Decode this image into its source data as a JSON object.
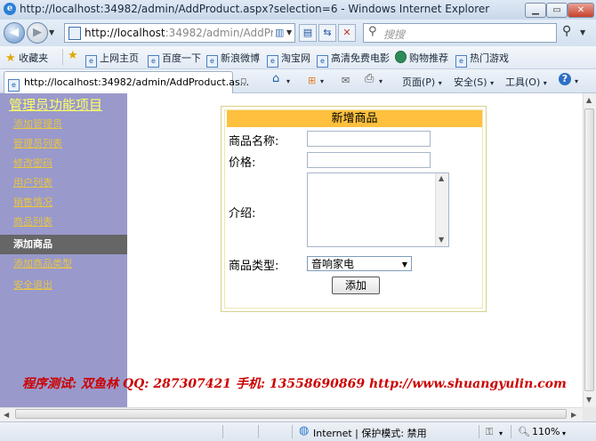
{
  "window": {
    "title": "http://localhost:34982/admin/AddProduct.aspx?selection=6 - Windows Internet Explorer",
    "min_icon": "minimize-icon",
    "max_icon": "maximize-icon",
    "close_icon": "close-icon"
  },
  "address": {
    "url_host": "http://localhost",
    "url_rest": ":34982/admin/AddProduc",
    "search_placeholder": "搜搜"
  },
  "favorites": {
    "label": "收藏夹",
    "items": [
      "上网主页",
      "百度一下",
      "新浪微博",
      "淘宝网",
      "高清免费电影",
      "购物推荐",
      "热门游戏"
    ]
  },
  "tab": {
    "title": "http://localhost:34982/admin/AddProduct.as..."
  },
  "commands": {
    "page": "页面(P)",
    "safety": "安全(S)",
    "tools": "工具(O)"
  },
  "sidebar": {
    "heading": "管理员功能项目",
    "items": [
      "添加管理员",
      "管理员列表",
      "修改密码",
      "用户列表",
      "销售情况",
      "商品列表",
      "添加商品",
      "添加商品类型",
      "安全退出"
    ],
    "active_index": 6
  },
  "form": {
    "title": "新增商品",
    "name_label": "商品名称:",
    "price_label": "价格:",
    "intro_label": "介绍:",
    "type_label": "商品类型:",
    "type_value": "音响家电",
    "submit_label": "添加",
    "header_color": "#fec03e"
  },
  "footer": {
    "text": "程序测试: 双鱼林   QQ: 287307421   手机: 13558690869   http://www.shuangyulin.com"
  },
  "status": {
    "zone": "Internet | 保护模式: 禁用",
    "zoom": "110%"
  },
  "colors": {
    "sidebar_bg": "#9999cc",
    "active_item_bg": "#666666",
    "menu_link": "#e8c542",
    "footer_text": "#cc0000"
  }
}
